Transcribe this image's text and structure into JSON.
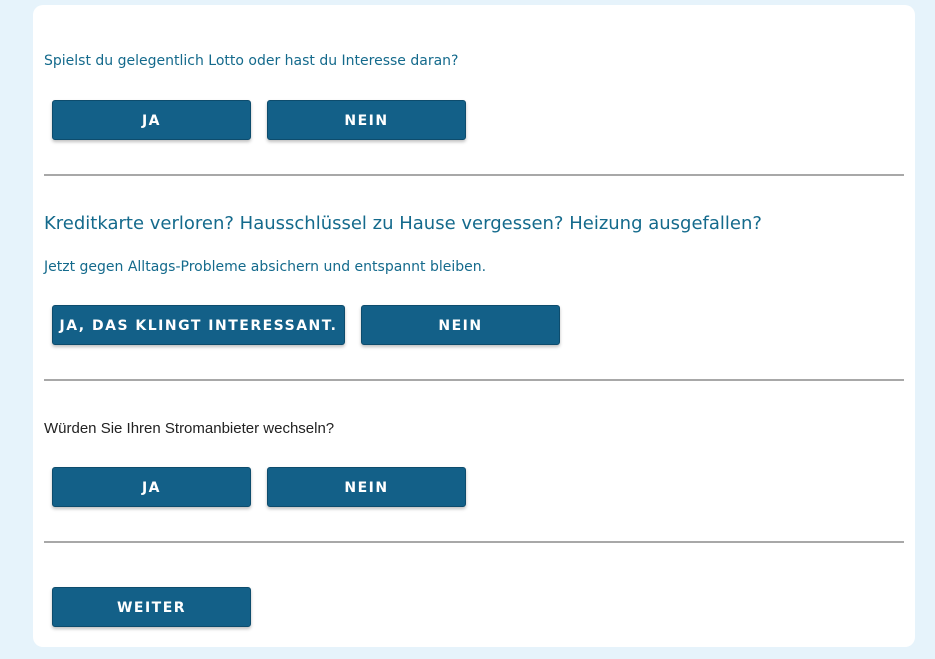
{
  "questions": [
    {
      "text": "Spielst du gelegentlich Lotto oder hast du Interesse daran?",
      "yes_label": "JA",
      "no_label": "NEIN"
    },
    {
      "heading": "Kreditkarte verloren? Hausschlüssel zu Hause vergessen? Heizung ausgefallen?",
      "text": "Jetzt gegen Alltags-Probleme absichern und entspannt bleiben.",
      "yes_label": "JA, DAS KLINGT INTERESSANT.",
      "no_label": "NEIN"
    },
    {
      "text": "Würden Sie Ihren Stromanbieter wechseln?",
      "yes_label": "JA",
      "no_label": "NEIN"
    }
  ],
  "continue_label": "WEITER",
  "colors": {
    "background": "#e6f3fb",
    "button": "#136088",
    "question_text": "#146a8c",
    "divider": "#a8a8a8"
  }
}
